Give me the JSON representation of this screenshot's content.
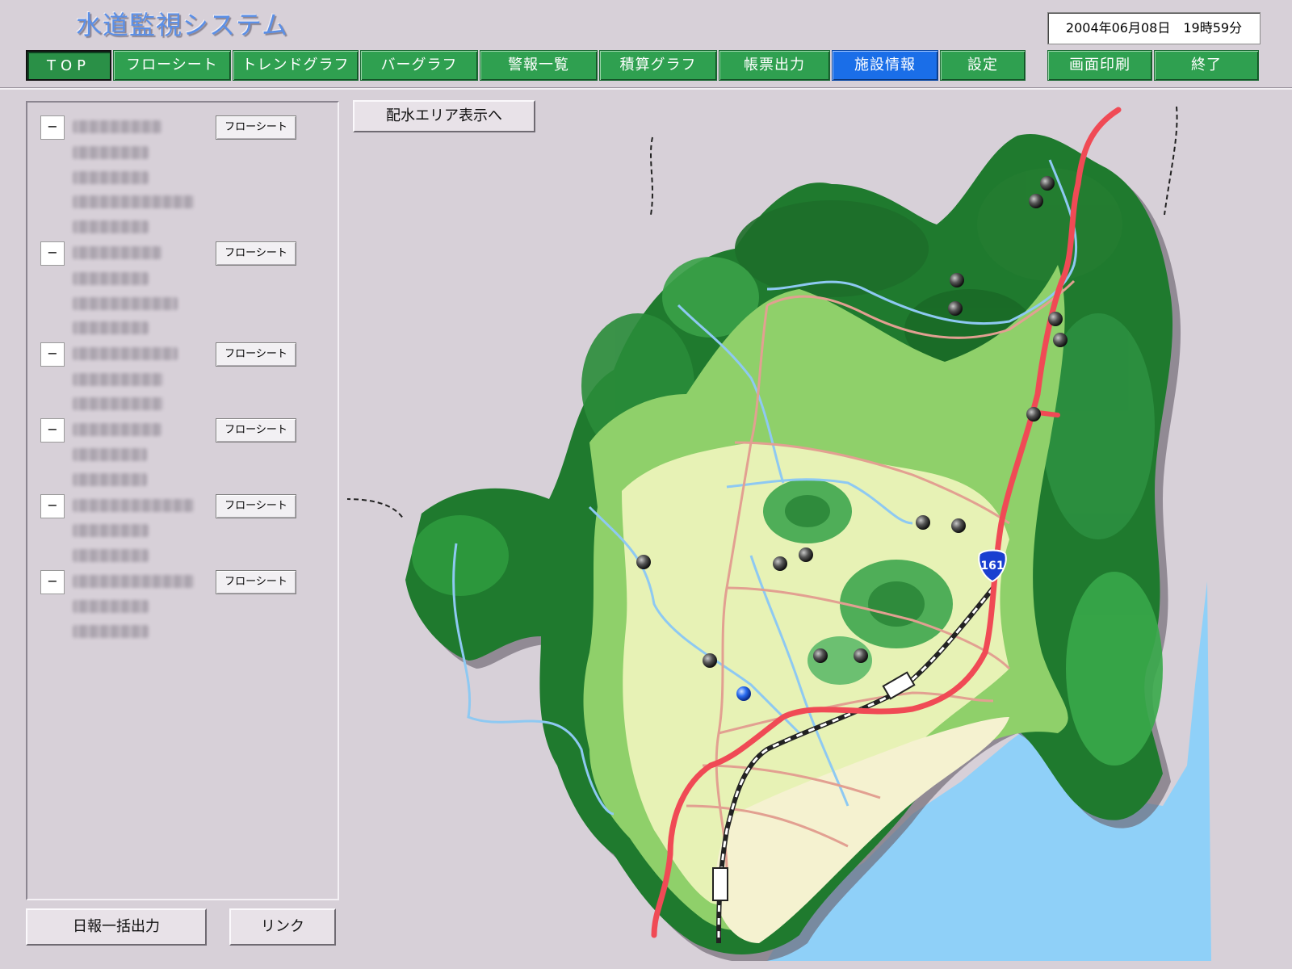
{
  "app": {
    "title": "水道監視システム",
    "datetime": "2004年06月08日　19時59分"
  },
  "nav": {
    "top": "TOP",
    "flowsheet": "フローシート",
    "trend_graph": "トレンドグラフ",
    "bar_graph": "バーグラフ",
    "alarm_list": "警報一覧",
    "integration_graph": "積算グラフ",
    "report_output": "帳票出力",
    "facility_info": "施設情報",
    "settings": "設定",
    "print_screen": "画面印刷",
    "exit": "終了",
    "active": "施設情報"
  },
  "sidebar": {
    "toggle_symbol": "−",
    "flow_button_label": "フローシート",
    "groups_count_note": ""
  },
  "buttons": {
    "area_display": "配水エリア表示へ",
    "daily_report": "日報一括出力",
    "link": "リンク"
  },
  "map": {
    "route_label": "161",
    "colors": {
      "sea": "#8fd0f8",
      "background": "#d7d0d8",
      "route": "#f04a55",
      "road": "#e2a091",
      "river": "#8ec9f2"
    }
  }
}
